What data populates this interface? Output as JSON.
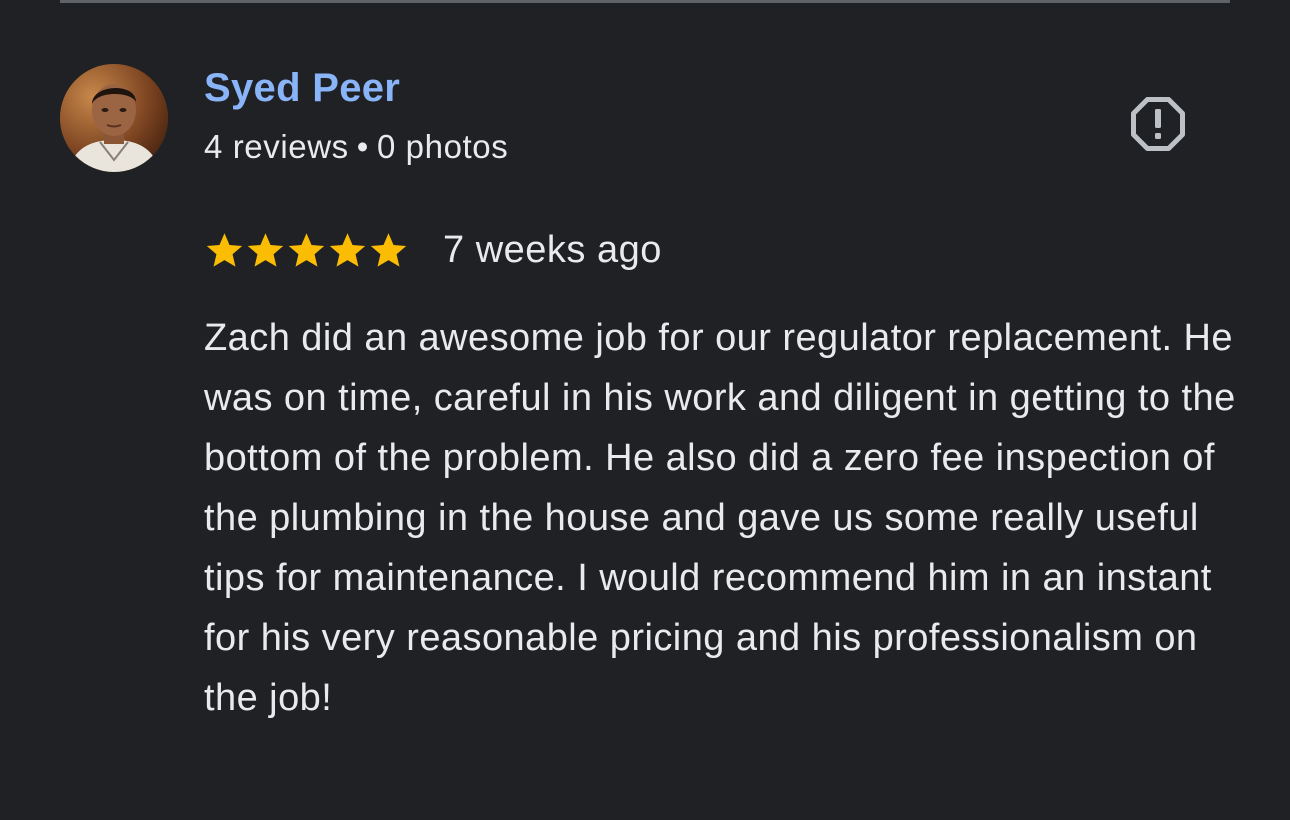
{
  "review": {
    "author": {
      "name": "Syed Peer",
      "reviews_count": "4 reviews",
      "separator": "•",
      "photos_count": "0 photos",
      "avatar": "profile-photo"
    },
    "report_icon": "report-flag-icon",
    "rating": {
      "stars": 5,
      "max_stars": 5,
      "star_color": "#fbbc04"
    },
    "time_ago": "7 weeks ago",
    "text": "Zach did an awesome job for our regulator replacement. He was on time, careful in his work and diligent in getting to the bottom of the problem. He also did a zero fee inspection of the plumbing in the house and gave us some really useful tips for maintenance. I would recommend him in an instant for his very reasonable pricing and his professionalism on the job!"
  },
  "colors": {
    "background": "#202124",
    "author_name": "#8ab4f8",
    "text": "#e8eaed",
    "divider": "#5f6368",
    "icon": "#bdc1c6"
  }
}
